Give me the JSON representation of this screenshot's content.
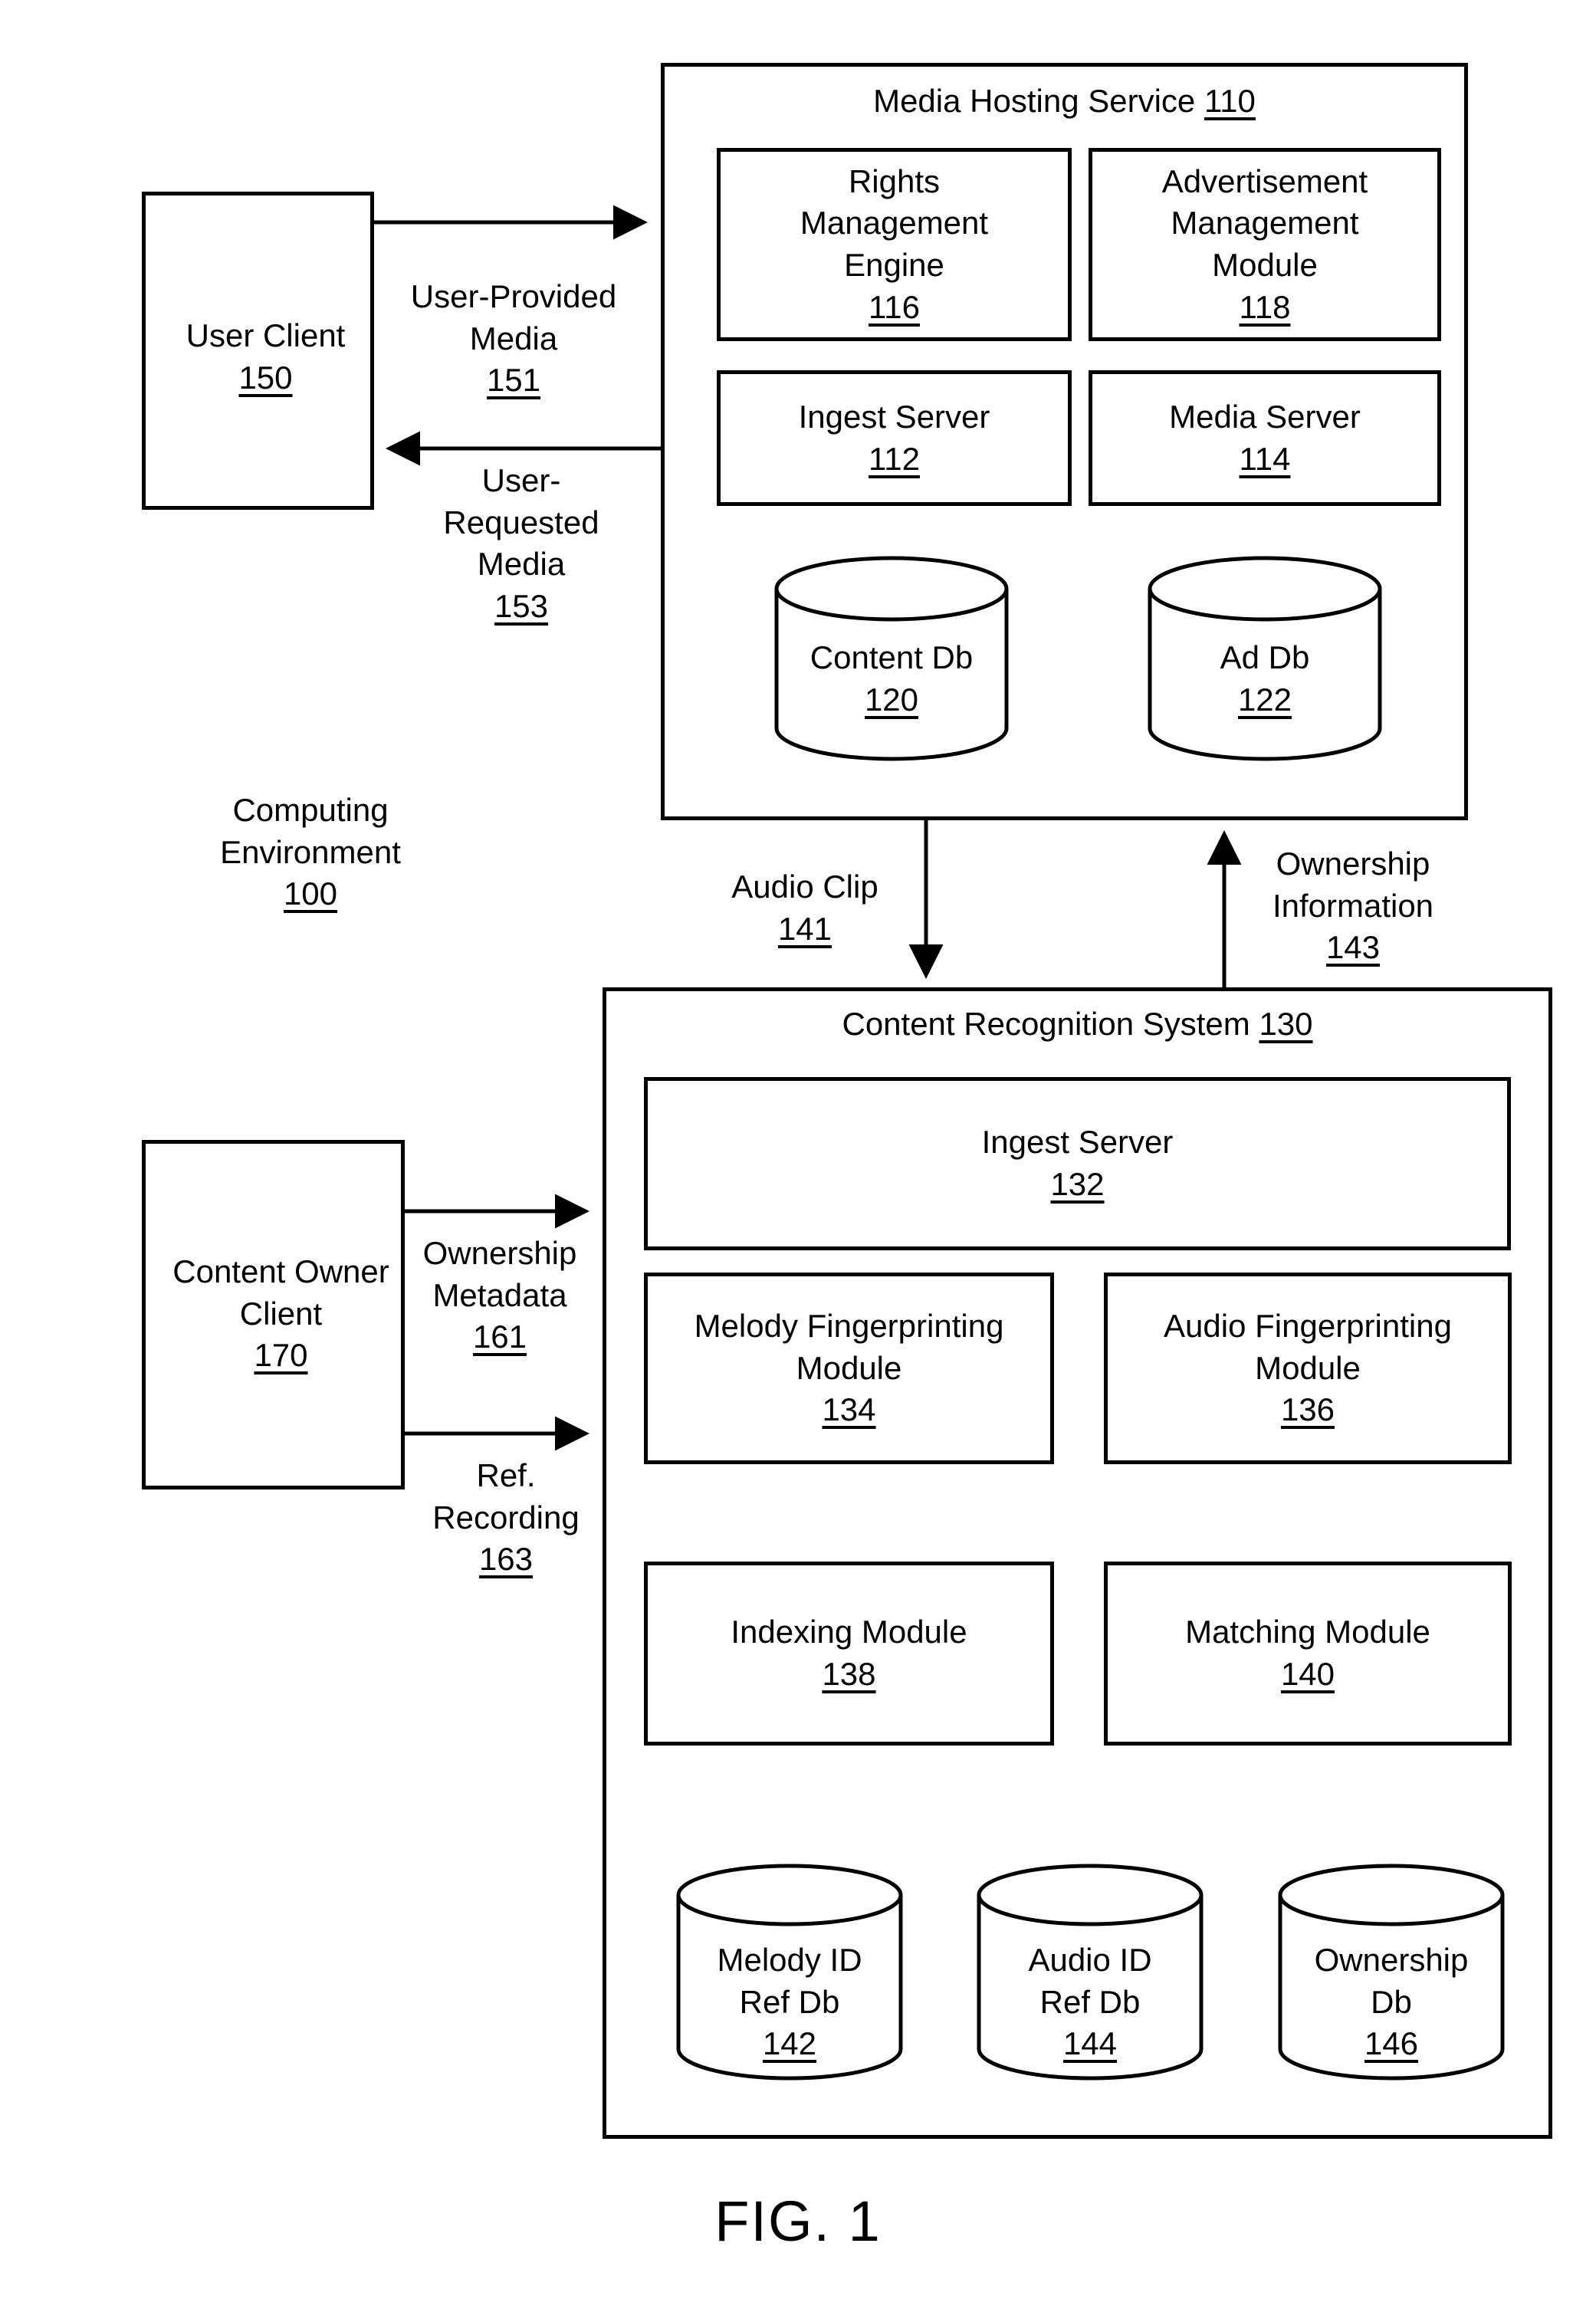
{
  "figure": {
    "caption": "FIG. 1"
  },
  "environment": {
    "name": "Computing",
    "name2": "Environment",
    "number": "100"
  },
  "clients": {
    "user_client": {
      "line1": "User Client",
      "number": "150"
    },
    "content_owner_client": {
      "line1": "Content Owner",
      "line2": "Client",
      "number": "170"
    }
  },
  "media_hosting_service": {
    "title": "Media Hosting Service",
    "title_number": "110",
    "components": [
      {
        "line1": "Rights",
        "line2": "Management",
        "line3": "Engine",
        "number": "116"
      },
      {
        "line1": "Advertisement",
        "line2": "Management",
        "line3": "Module",
        "number": "118"
      },
      {
        "line1": "Ingest Server",
        "number": "112"
      },
      {
        "line1": "Media Server",
        "number": "114"
      }
    ],
    "databases": [
      {
        "line1": "Content Db",
        "number": "120"
      },
      {
        "line1": "Ad Db",
        "number": "122"
      }
    ]
  },
  "content_recognition_system": {
    "title": "Content Recognition System",
    "title_number": "130",
    "components": [
      {
        "line1": "Ingest Server",
        "number": "132"
      },
      {
        "line1": "Melody Fingerprinting",
        "line2": "Module",
        "number": "134"
      },
      {
        "line1": "Audio Fingerprinting",
        "line2": "Module",
        "number": "136"
      },
      {
        "line1": "Indexing Module",
        "number": "138"
      },
      {
        "line1": "Matching Module",
        "number": "140"
      }
    ],
    "databases": [
      {
        "line1": "Melody ID",
        "line2": "Ref Db",
        "number": "142"
      },
      {
        "line1": "Audio ID",
        "line2": "Ref Db",
        "number": "144"
      },
      {
        "line1": "Ownership",
        "line2": "Db",
        "number": "146"
      }
    ]
  },
  "flows": [
    {
      "line1": "User-Provided",
      "line2": "Media",
      "number": "151"
    },
    {
      "line1": "User-",
      "line2": "Requested",
      "line3": "Media",
      "number": "153"
    },
    {
      "line1": "Audio Clip",
      "number": "141"
    },
    {
      "line1": "Ownership",
      "line2": "Information",
      "number": "143"
    },
    {
      "line1": "Ownership",
      "line2": "Metadata",
      "number": "161"
    },
    {
      "line1": "Ref.",
      "line2": "Recording",
      "number": "163"
    }
  ],
  "colors": {
    "stroke": "#000000",
    "background": "#ffffff"
  }
}
